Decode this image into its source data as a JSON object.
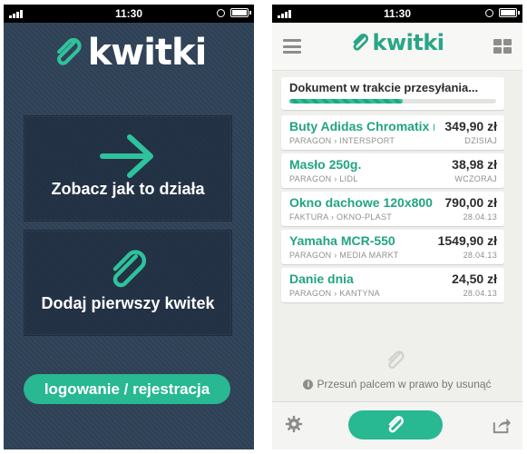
{
  "status_bar": {
    "time": "11:30"
  },
  "left_screen": {
    "logo_text": "kwitki",
    "demo_card_label": "Zobacz jak to działa",
    "add_card_label": "Dodaj pierwszy kwitek",
    "login_button_label": "logowanie / rejestracja",
    "colors": {
      "background": "#2f4257",
      "accent": "#28b892"
    }
  },
  "right_screen": {
    "logo_text": "kwitki",
    "upload": {
      "text": "Dokument w trakcie przesyłania...",
      "progress": 0.55
    },
    "receipts": [
      {
        "name": "Buty Adidas Chromatix r...",
        "amount": "349,90 zł",
        "type": "PARAGON",
        "store": "INTERSPORT",
        "date": "DZISIAJ"
      },
      {
        "name": "Masło 250g.",
        "amount": "38,98 zł",
        "type": "PARAGON",
        "store": "LIDL",
        "date": "WCZORAJ"
      },
      {
        "name": "Okno dachowe 120x800",
        "amount": "790,00 zł",
        "type": "FAKTURA",
        "store": "OKNO-PLAST",
        "date": "28.04.13"
      },
      {
        "name": "Yamaha MCR-550",
        "amount": "1549,90 zł",
        "type": "PARAGON",
        "store": "MEDIA MARKT",
        "date": "28.04.13"
      },
      {
        "name": "Danie dnia",
        "amount": "24,50 zł",
        "type": "PARAGON",
        "store": "KANTYNA",
        "date": "28.04.13"
      }
    ],
    "hint_text": "Przesuń palcem w prawo by usunąć",
    "icons": {
      "menu": "hamburger-icon",
      "grid": "grid-icon",
      "settings": "gear-icon",
      "add": "paperclip-icon",
      "share": "share-icon"
    },
    "colors": {
      "accent": "#28b892",
      "item_name": "#22a482"
    }
  }
}
